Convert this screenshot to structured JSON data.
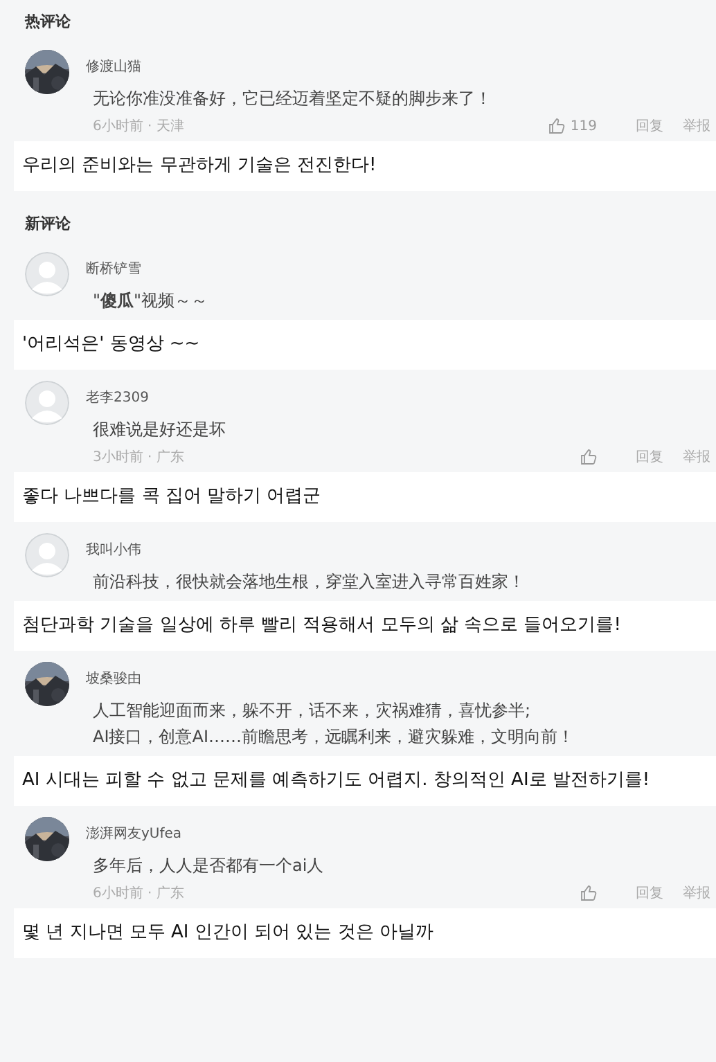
{
  "sections": [
    {
      "title": "热评论",
      "comments": [
        {
          "name": "修渡山猫",
          "body": "无论你准没准备好，它已经迈着坚定不疑的脚步来了！",
          "meta": "6小时前 · 天津",
          "likes": "119",
          "actions": [
            "回复",
            "举报"
          ],
          "translation": "우리의 준비와는 무관하게 기술은 전진한다!"
        }
      ]
    },
    {
      "title": "新评论",
      "comments": [
        {
          "avatar": {
            "kind": "default"
          },
          "name": "断桥铲雪",
          "body": "\"**傻瓜**\"视频～～",
          "translation": "'어리석은' 동영상 ~~"
        },
        {
          "avatar": {
            "kind": "default"
          },
          "name": "老李2309",
          "body": "很难说是好还是坏",
          "meta": "3小时前 · 广东",
          "actions": [
            "回复",
            "举报"
          ],
          "translation": "좋다 나쁘다를 콕 집어 말하기 어렵군"
        },
        {
          "avatar": {
            "kind": "default"
          },
          "name": "我叫小伟",
          "body": "前沿科技，很快就会落地生根，穿堂入室进入寻常百姓家！",
          "translation": "첨단과학 기술을 일상에 하루 빨리 적용해서 모두의 삶 속으로 들어오기를!"
        },
        {
          "name": "坡桑骏由",
          "body": "人工智能迎面而来，躲不开，话不来，灾祸难猜，喜忧参半;\nAI接口，创意AI……前瞻思考，远瞩利来，避灾躲难，文明向前！",
          "translation": "AI 시대는 피할 수 없고 문제를 예측하기도 어렵지. 창의적인 AI로 발전하기를!"
        },
        {
          "name": "澎湃网友yUfea",
          "body": "多年后，人人是否都有一个ai人",
          "meta": "6小时前 · 广东",
          "actions": [
            "回复",
            "举报"
          ],
          "translation": "몇 년 지나면 모두 AI 인간이 되어 있는 것은 아닐까"
        }
      ]
    }
  ]
}
